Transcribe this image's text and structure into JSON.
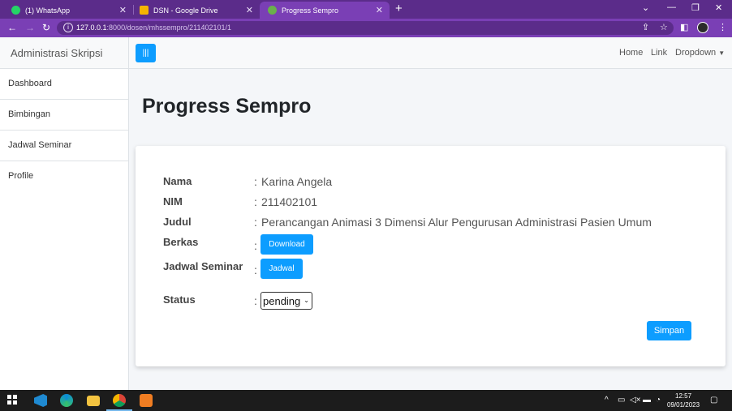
{
  "browser": {
    "tabs": [
      {
        "title": "(1) WhatsApp",
        "color": "#25d366"
      },
      {
        "title": "DSN - Google Drive",
        "color": "#f4b400"
      },
      {
        "title": "Progress Sempro",
        "color": "#6ab04c"
      }
    ],
    "url_host": "127.0.0.1",
    "url_path": ":8000/dosen/mhssempro/211402101/1"
  },
  "app": {
    "brand": "Administrasi Skripsi",
    "sidebar": [
      "Dashboard",
      "Bimbingan",
      "Jadwal Seminar",
      "Profile"
    ],
    "topnav": {
      "home": "Home",
      "link": "Link",
      "dropdown": "Dropdown"
    },
    "page_title": "Progress Sempro",
    "detail": {
      "nama_label": "Nama",
      "nama_value": "Karina Angela",
      "nim_label": "NIM",
      "nim_value": "211402101",
      "judul_label": "Judul",
      "judul_value": "Perancangan Animasi 3 Dimensi Alur Pengurusan Administrasi Pasien Umum",
      "berkas_label": "Berkas",
      "download_button": "Download",
      "jadwal_label": "Jadwal Seminar",
      "jadwal_button": "Jadwal",
      "status_label": "Status",
      "status_value": "pending",
      "separator": ":"
    },
    "save_button": "Simpan"
  },
  "taskbar": {
    "time": "12:57",
    "date": "09/01/2023"
  },
  "colors": {
    "accent": "#0d9dff",
    "browser_frame": "#7a3fb5"
  }
}
